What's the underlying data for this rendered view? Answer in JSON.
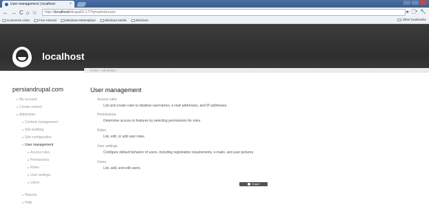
{
  "browser": {
    "tab_title": "User management | localhost",
    "tab_close": "×",
    "nav_back": "←",
    "nav_forward": "→",
    "nav_reload": "C",
    "nav_home": "⌂",
    "star": "☆",
    "url_prefix": "http://",
    "url_host": "localhost",
    "url_rest": "/drupal/6.17/?q=admin/user",
    "page_menu": "▸",
    "page_icon": "🗋▾",
    "wrench_icon": "🔧",
    "bookmarks": [
      "Customize Links",
      "Free Hotmail",
      "Windows Marketplace",
      "Windows Media",
      "Windows"
    ],
    "other_bookmarks": "Other bookmarks"
  },
  "header": {
    "site_name": "localhost"
  },
  "breadcrumb": "Home › Administer ›",
  "sidebar": {
    "title": "persiandrupal.com",
    "items": [
      {
        "label": "My account",
        "active": false
      },
      {
        "label": "Create content",
        "active": false
      },
      {
        "label": "Administer",
        "active": false
      },
      {
        "label": "Content management",
        "active": false
      },
      {
        "label": "Site building",
        "active": false
      },
      {
        "label": "Site configuration",
        "active": false
      },
      {
        "label": "User management",
        "active": true
      },
      {
        "label": "Access rules",
        "active": false
      },
      {
        "label": "Permissions",
        "active": false
      },
      {
        "label": "Roles",
        "active": false
      },
      {
        "label": "User settings",
        "active": false
      },
      {
        "label": "Users",
        "active": false
      },
      {
        "label": "Reports",
        "active": false
      },
      {
        "label": "Help",
        "active": false
      }
    ]
  },
  "main": {
    "title": "User management",
    "sections": [
      {
        "title": "Access rules",
        "description": "List and create rules to disallow usernames, e-mail addresses, and IP addresses."
      },
      {
        "title": "Permissions",
        "description": "Determine access to features by selecting permissions for roles."
      },
      {
        "title": "Roles",
        "description": "List, edit, or add user roles."
      },
      {
        "title": "User settings",
        "description": "Configure default behavior of users, including registration requirements, e-mails, and user pictures."
      },
      {
        "title": "Users",
        "description": "List, add, and edit users."
      }
    ]
  },
  "footer": {
    "badge_text": "Drupal"
  }
}
